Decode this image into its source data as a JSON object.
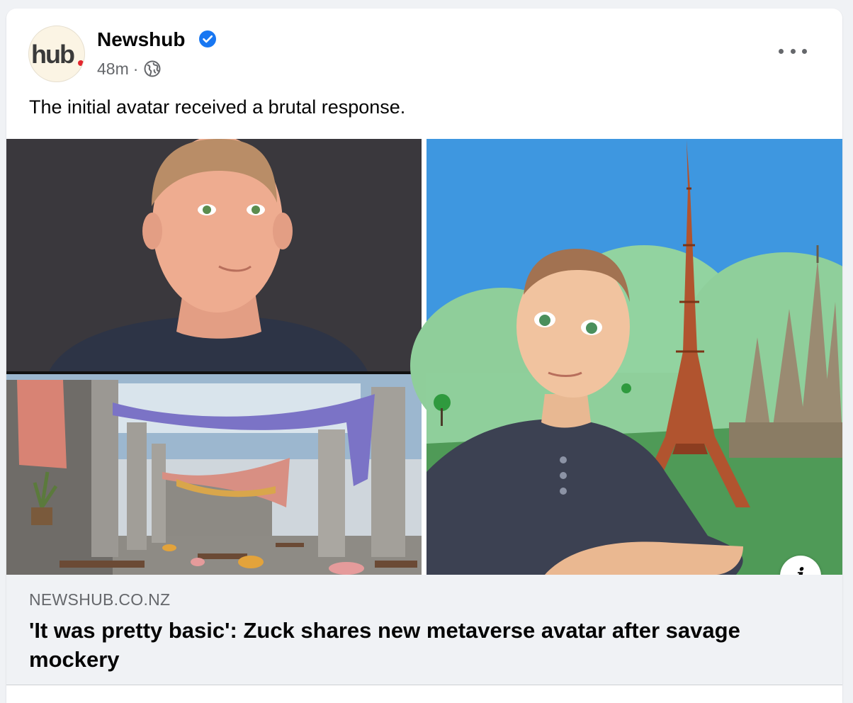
{
  "post": {
    "page_name": "Newshub",
    "avatar_logo_text": "hub",
    "timestamp": "48m",
    "separator": "·",
    "audience_icon": "globe-icon",
    "verified_icon": "verified-badge-icon",
    "more_icon": "more-options-icon",
    "caption": "The initial avatar received a brutal response.",
    "colors": {
      "verified": "#1877f2",
      "meta_text": "#65676b",
      "link_box_bg": "#f0f2f5",
      "logo_dot": "#e3262f"
    }
  },
  "media": {
    "panels": [
      "avatar-portrait-panel",
      "ancient-ruins-scene-panel",
      "avatar-paris-scene-panel"
    ],
    "info_icon": "info-icon",
    "info_label": "i"
  },
  "link_preview": {
    "domain": "NEWSHUB.CO.NZ",
    "headline": "'It was pretty basic': Zuck shares new metaverse avatar after savage mockery"
  }
}
